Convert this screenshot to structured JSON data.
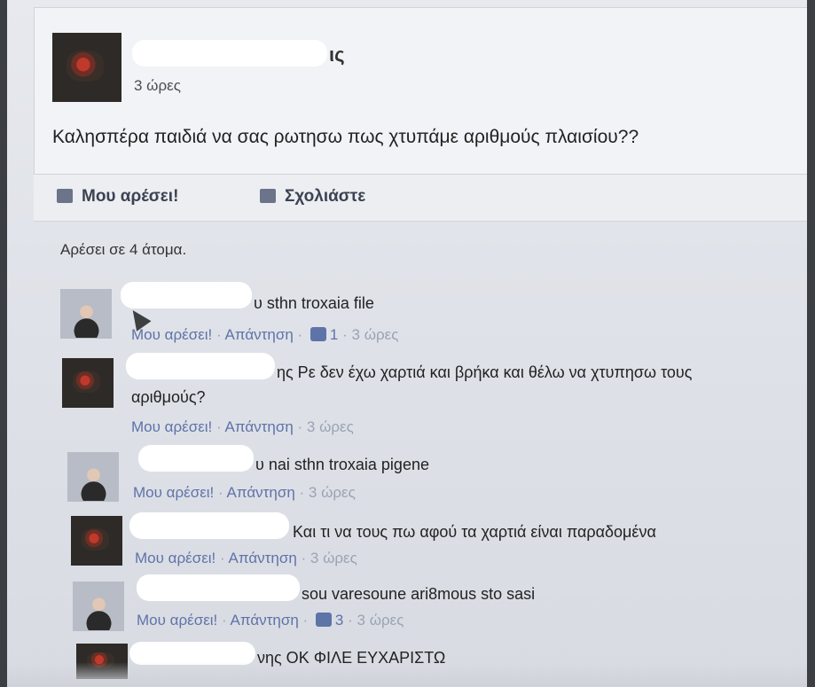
{
  "post": {
    "author_visible_tail": "ις",
    "time": "3 ώρες",
    "text": "Καλησπέρα παιδιά να σας ρωτησω πως χτυπάμε αριθμούς πλαισίου??",
    "actions": {
      "like": "Μου αρέσει!",
      "comment": "Σχολιάστε"
    },
    "likes_summary": "Αρέσει σε 4 άτομα."
  },
  "comment_actions": {
    "like": "Μου αρέσει!",
    "reply": "Απάντηση",
    "separator": "·"
  },
  "comments": [
    {
      "text_tail": "υ sthn troxaia file",
      "like_count": "1",
      "time": "3 ώρες"
    },
    {
      "text_tail": "ης Ρε δεν έχω χαρτιά και βρήκα και θέλω να χτυπησω τους",
      "text_line2": "αριθμούς?",
      "time": "3 ώρες"
    },
    {
      "text_tail": "υ nai sthn troxaia pigene",
      "time": "3 ώρες"
    },
    {
      "text_tail": "Και τι να τους πω αφού τα χαρτιά είναι παραδομένα",
      "time": "3 ώρες"
    },
    {
      "text_tail": "sou varesoune ari8mous sto sasi",
      "like_count": "3",
      "time": "3 ώρες"
    },
    {
      "text_tail": "νης ΟΚ ΦΙΛΕ ΕΥΧΑΡΙΣΤΩ"
    }
  ]
}
